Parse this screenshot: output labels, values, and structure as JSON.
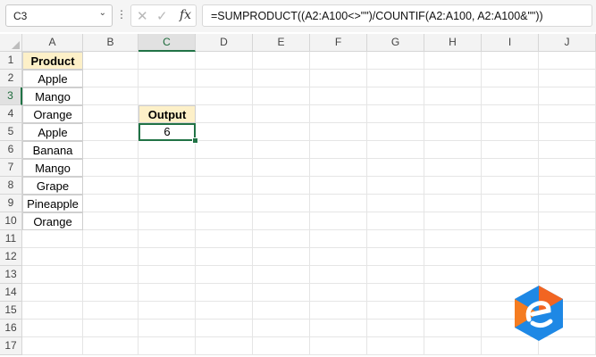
{
  "formula_bar": {
    "name_box": "C3",
    "formula": "=SUMPRODUCT((A2:A100<>\"\")/COUNTIF(A2:A100, A2:A100&\"\"))",
    "icons": [
      "cancel-icon",
      "enter-icon",
      "function-icon"
    ]
  },
  "grid": {
    "columns": [
      "A",
      "B",
      "C",
      "D",
      "E",
      "F",
      "G",
      "H",
      "I",
      "J"
    ],
    "rows": [
      "1",
      "2",
      "3",
      "4",
      "5",
      "6",
      "7",
      "8",
      "9",
      "10",
      "11",
      "12",
      "13",
      "14",
      "15",
      "16",
      "17"
    ],
    "selected_cell": "C3"
  },
  "data_table": {
    "header": "Product",
    "items": [
      "Apple",
      "Mango",
      "Orange",
      "Apple",
      "Banana",
      "Mango",
      "Grape",
      "Pineapple",
      "Orange"
    ]
  },
  "output": {
    "header": "Output",
    "value": "6"
  },
  "colors": {
    "accent": "#217346",
    "header_fill": "#fdf0c8",
    "logo_orange": "#f26522",
    "logo_blue": "#1e88e5"
  }
}
